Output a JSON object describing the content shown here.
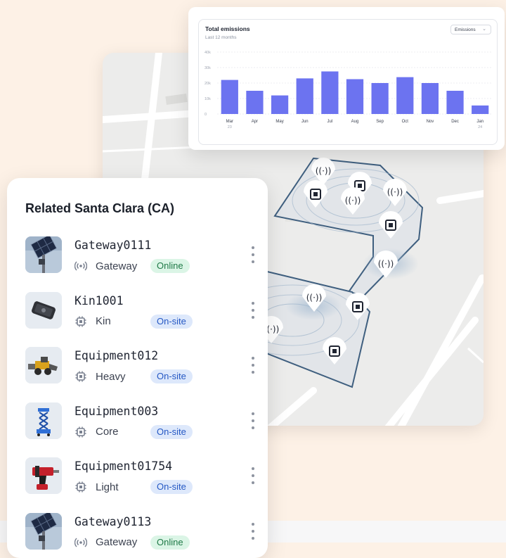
{
  "chart_card": {
    "title": "Total emissions",
    "subtitle": "Last 12 months",
    "select_value": "Emissions"
  },
  "chart_data": {
    "type": "bar",
    "title": "Total emissions",
    "subtitle": "Last 12 months",
    "categories": [
      "Mar",
      "Apr",
      "May",
      "Jun",
      "Jul",
      "Aug",
      "Sep",
      "Oct",
      "Nov",
      "Dec",
      "Jan"
    ],
    "category_sublabels": [
      "23",
      "",
      "",
      "",
      "",
      "",
      "",
      "",
      "",
      "",
      "24"
    ],
    "values": [
      22000,
      15000,
      12000,
      23000,
      27500,
      22500,
      20000,
      23800,
      20000,
      15000,
      5500
    ],
    "ylim": [
      0,
      40000
    ],
    "yticks": [
      0,
      10000,
      20000,
      30000,
      40000
    ],
    "ytick_labels": [
      "0",
      "10k",
      "20k",
      "30k",
      "40k"
    ],
    "bar_color": "#6c73f0",
    "grid": true
  },
  "list": {
    "title": "Related Santa Clara (CA)",
    "items": [
      {
        "name": "Gateway0111",
        "type": "Gateway",
        "type_icon": "gateway-icon",
        "status": "Online",
        "status_kind": "online",
        "thumb": "solar-gateway-image"
      },
      {
        "name": "Kin1001",
        "type": "Kin",
        "type_icon": "chip-icon",
        "status": "On-site",
        "status_kind": "onsite",
        "thumb": "tracker-device-image"
      },
      {
        "name": "Equipment012",
        "type": "Heavy",
        "type_icon": "chip-icon",
        "status": "On-site",
        "status_kind": "onsite",
        "thumb": "loader-image"
      },
      {
        "name": "Equipment003",
        "type": "Core",
        "type_icon": "chip-icon",
        "status": "On-site",
        "status_kind": "onsite",
        "thumb": "scissor-lift-image"
      },
      {
        "name": "Equipment01754",
        "type": "Light",
        "type_icon": "chip-icon",
        "status": "On-site",
        "status_kind": "onsite",
        "thumb": "power-drill-image"
      },
      {
        "name": "Gateway0113",
        "type": "Gateway",
        "type_icon": "gateway-icon",
        "status": "Online",
        "status_kind": "online",
        "thumb": "solar-gateway-image"
      }
    ]
  },
  "colors": {
    "accent": "#6c73f0",
    "online_bg": "#dbf5e6",
    "online_text": "#1f7a47",
    "onsite_bg": "#dde8fb",
    "onsite_text": "#2558c4",
    "zone_border": "#3f5f7f"
  }
}
